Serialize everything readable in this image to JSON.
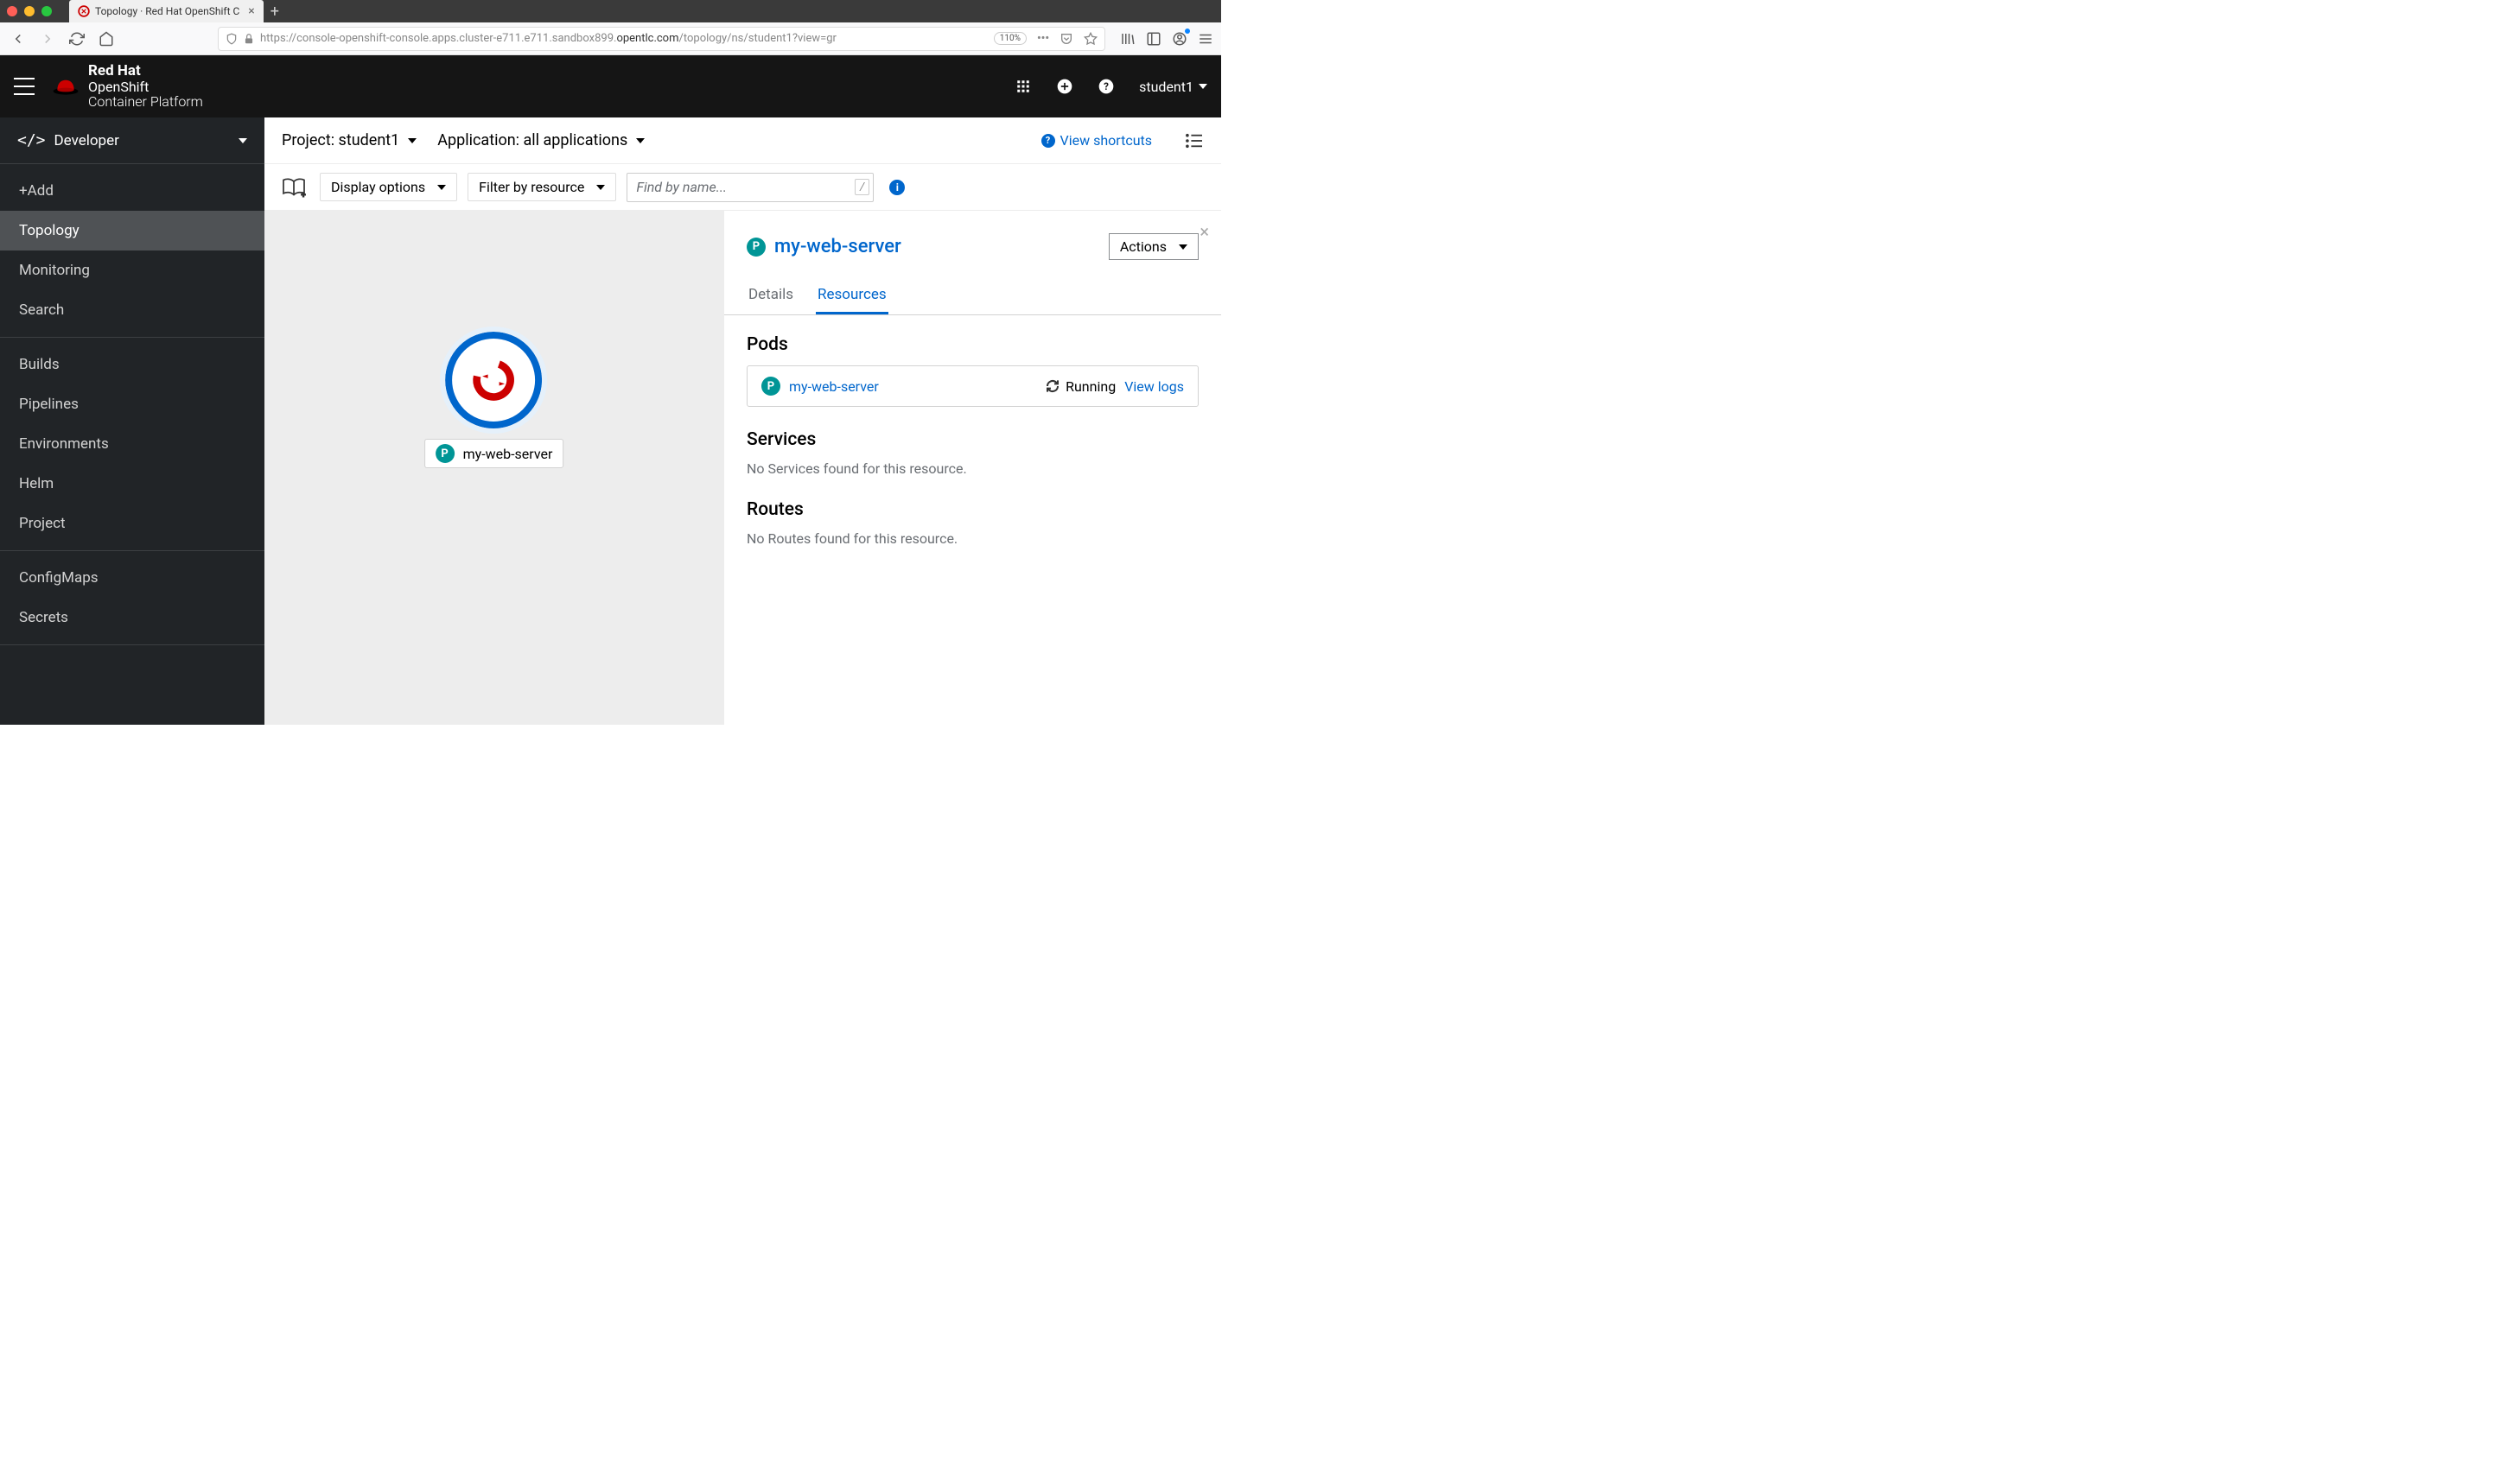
{
  "browser": {
    "tab_title": "Topology · Red Hat OpenShift C",
    "url_prefix": "https://console-openshift-console.apps.cluster-e711.e711.sandbox899.",
    "url_domain": "opentlc.com",
    "url_suffix": "/topology/ns/student1?view=gr",
    "zoom": "110%"
  },
  "header": {
    "brand_line1": "Red Hat",
    "brand_line2": "OpenShift",
    "brand_line3": "Container Platform",
    "user": "student1"
  },
  "sidebar": {
    "perspective": "Developer",
    "groups": [
      {
        "items": [
          {
            "label": "+Add",
            "active": false
          },
          {
            "label": "Topology",
            "active": true
          },
          {
            "label": "Monitoring",
            "active": false
          },
          {
            "label": "Search",
            "active": false
          }
        ]
      },
      {
        "items": [
          {
            "label": "Builds",
            "active": false
          },
          {
            "label": "Pipelines",
            "active": false
          },
          {
            "label": "Environments",
            "active": false
          },
          {
            "label": "Helm",
            "active": false
          },
          {
            "label": "Project",
            "active": false
          }
        ]
      },
      {
        "items": [
          {
            "label": "ConfigMaps",
            "active": false
          },
          {
            "label": "Secrets",
            "active": false
          }
        ]
      }
    ]
  },
  "context": {
    "project_label": "Project: student1",
    "application_label": "Application: all applications",
    "shortcuts_label": "View shortcuts"
  },
  "filters": {
    "display_options": "Display options",
    "filter_resource": "Filter by resource",
    "search_placeholder": "Find by name...",
    "slash": "/"
  },
  "topology": {
    "node_label": "my-web-server",
    "badge": "P"
  },
  "panel": {
    "title": "my-web-server",
    "badge": "P",
    "actions": "Actions",
    "tabs": [
      {
        "label": "Details",
        "active": false
      },
      {
        "label": "Resources",
        "active": true
      }
    ],
    "pods": {
      "heading": "Pods",
      "items": [
        {
          "name": "my-web-server",
          "status": "Running",
          "logs": "View logs",
          "badge": "P"
        }
      ]
    },
    "services": {
      "heading": "Services",
      "empty": "No Services found for this resource."
    },
    "routes": {
      "heading": "Routes",
      "empty": "No Routes found for this resource."
    }
  }
}
